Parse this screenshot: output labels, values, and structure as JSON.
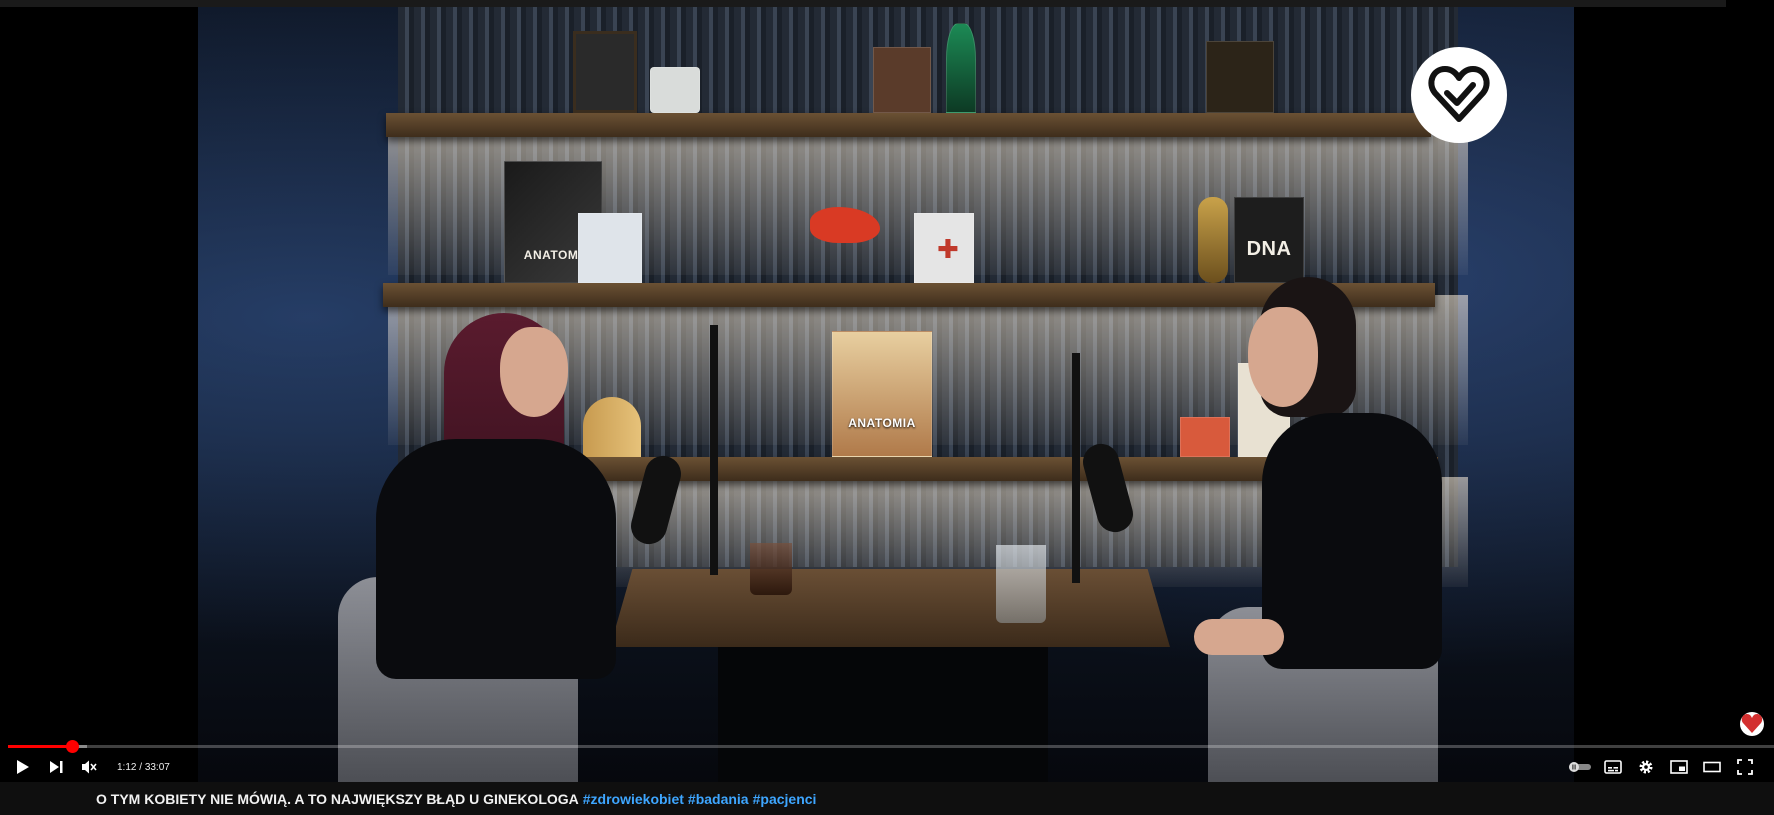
{
  "video": {
    "books": {
      "anatomia_top": "ANATOMI",
      "dna": "DNA",
      "anatomia_mid": "ANATOMIA"
    }
  },
  "player": {
    "time_current": "1:12",
    "time_separator": "/",
    "time_total": "33:07",
    "progress_played": 0.036,
    "progress_loaded": 0.045
  },
  "title": {
    "text": "O TYM KOBIETY NIE MÓWIĄ. A TO NAJWIĘKSZY BŁĄD U GINEKOLOGA",
    "hashtags": [
      "#zdrowiekobiet",
      "#badania",
      "#pacjenci"
    ]
  },
  "colors": {
    "accent": "#ff0000",
    "hashtag": "#3ea6ff",
    "bar_bg": "#0f0f0f"
  },
  "icons": {
    "play": "play-icon",
    "next": "next-icon",
    "mute": "volume-muted-icon",
    "autoplay": "autoplay-toggle-icon",
    "subtitles": "subtitles-icon",
    "settings": "gear-icon",
    "miniplayer": "miniplayer-icon",
    "theater": "theater-mode-icon",
    "fullscreen": "fullscreen-icon"
  }
}
